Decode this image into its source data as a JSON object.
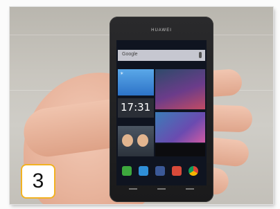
{
  "photo": {
    "phone_brand": "HUAWEI",
    "screen": {
      "search_text": "Google",
      "clock_time": "17:31"
    }
  },
  "badge": {
    "number": "3",
    "border_color": "#f2b221"
  }
}
